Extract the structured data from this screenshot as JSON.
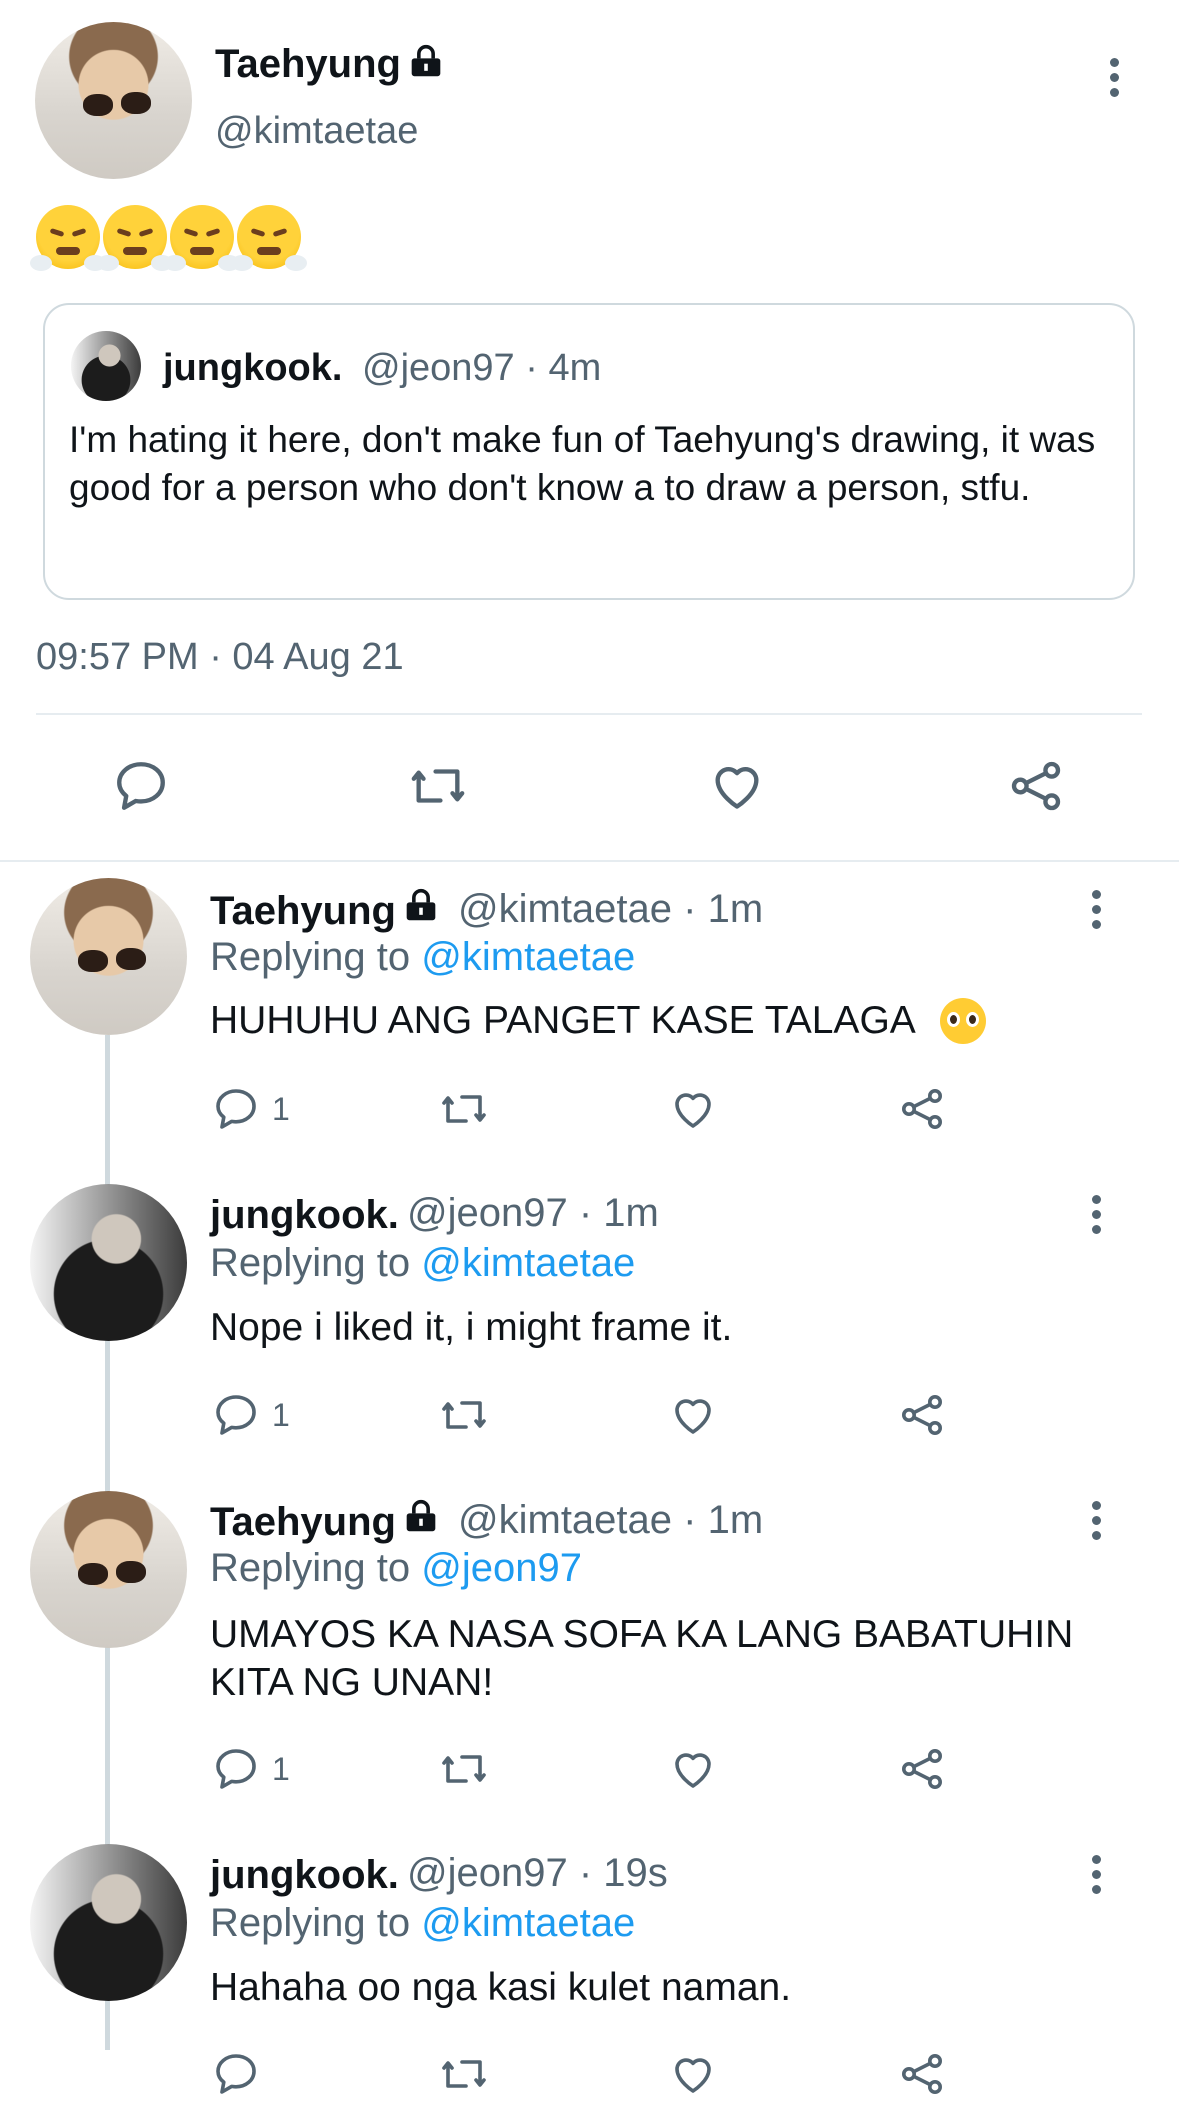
{
  "main_tweet": {
    "author_name": "Taehyung",
    "handle": "@kimtaetae",
    "emoji_text": "😤😤😤😤",
    "timestamp": "09:57 PM · 04 Aug 21",
    "quoted": {
      "author_name": "jungkook.",
      "handle_time": "@jeon97 · 4m",
      "text": "I'm hating it here, don't make fun of Taehyung's drawing, it was good for a person who don't know a to draw a person, stfu."
    }
  },
  "replies": [
    {
      "author_name": "Taehyung",
      "handle_time": "@kimtaetae · 1m",
      "replying_prefix": "Replying to",
      "replying_to": "@kimtaetae",
      "text": "HUHUHU ANG PANGET KASE TALAGA",
      "reply_count": "1"
    },
    {
      "author_name": "jungkook.",
      "handle_time": "@jeon97 · 1m",
      "replying_prefix": "Replying to",
      "replying_to": "@kimtaetae",
      "text": "Nope i liked it, i might frame it.",
      "reply_count": "1"
    },
    {
      "author_name": "Taehyung",
      "handle_time": "@kimtaetae · 1m",
      "replying_prefix": "Replying to",
      "replying_to": "@jeon97",
      "text_line1": "UMAYOS KA NASA SOFA KA LANG BABATUHIN",
      "text_line2": "KITA NG UNAN!",
      "reply_count": "1"
    },
    {
      "author_name": "jungkook.",
      "handle_time": "@jeon97 · 19s",
      "replying_prefix": "Replying to",
      "replying_to": "@kimtaetae",
      "text": "Hahaha oo nga kasi kulet naman.",
      "reply_count": ""
    }
  ],
  "icons": {
    "reply": "speech-bubble-icon",
    "retweet": "retweet-arrows-icon",
    "like": "heart-icon",
    "share": "share-nodes-icon",
    "more": "vertical-ellipsis-icon",
    "protected": "lock-icon"
  },
  "colors": {
    "text": "#0f1419",
    "secondary": "#536471",
    "link": "#1d9bf0",
    "border": "#cfd9de"
  }
}
